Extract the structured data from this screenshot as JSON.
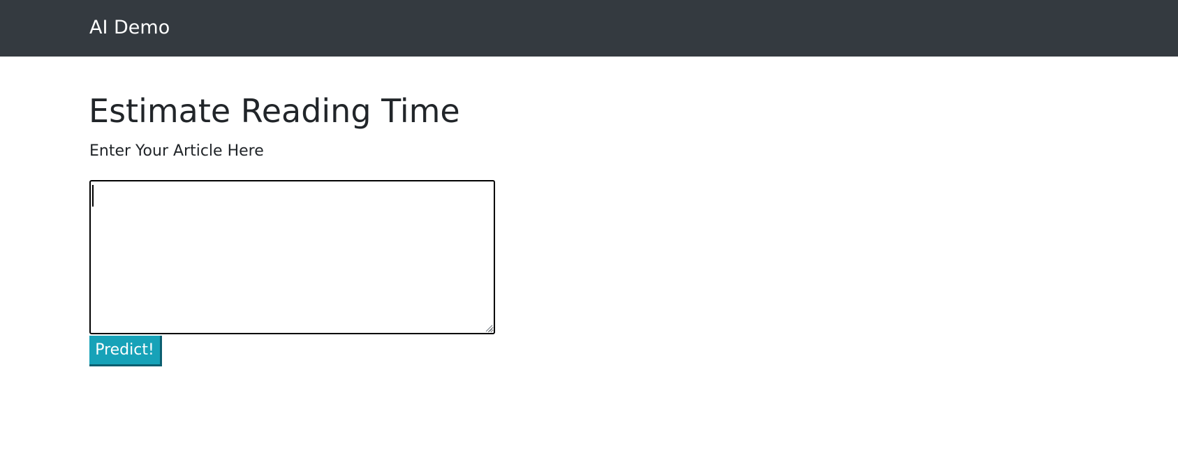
{
  "navbar": {
    "brand": "AI Demo",
    "background_color": "#343a40"
  },
  "main": {
    "title": "Estimate Reading Time",
    "label": "Enter Your Article Here",
    "article_input": {
      "value": "",
      "placeholder": ""
    },
    "predict_button": {
      "label": "Predict!",
      "color": "#17a2b8"
    }
  }
}
